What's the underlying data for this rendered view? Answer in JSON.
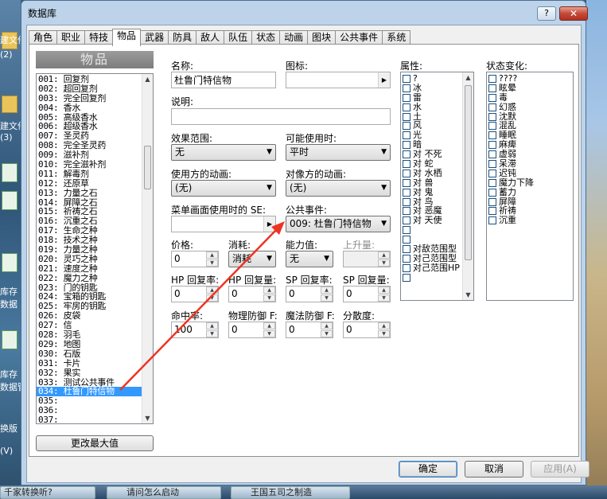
{
  "desktop": {
    "labels": [
      "建文件",
      "(2)",
      "建文件",
      "(3)",
      "库存",
      "数据",
      "库存",
      "数据管",
      "换版",
      "(V)"
    ]
  },
  "window": {
    "title": "数据库",
    "help": "?",
    "close": "✕"
  },
  "tabs": [
    "角色",
    "职业",
    "特技",
    "物品",
    "武器",
    "防具",
    "敌人",
    "队伍",
    "状态",
    "动画",
    "图块",
    "公共事件",
    "系统"
  ],
  "items": {
    "header": "物品",
    "list": [
      "001: 回复剂",
      "002: 超回复剂",
      "003: 完全回复剂",
      "004: 香水",
      "005: 高级香水",
      "006: 超级香水",
      "007: 圣灵药",
      "008: 完全圣灵药",
      "009: 滋补剂",
      "010: 完全滋补剂",
      "011: 解毒剂",
      "012: 还原草",
      "013: 力量之石",
      "014: 屏障之石",
      "015: 祈祷之石",
      "016: 沉重之石",
      "017: 生命之种",
      "018: 技术之种",
      "019: 力量之种",
      "020: 灵巧之种",
      "021: 速度之种",
      "022: 魔力之种",
      "023: 门的钥匙",
      "024: 宝箱的钥匙",
      "025: 牢房的钥匙",
      "026: 皮袋",
      "027: 信",
      "028: 羽毛",
      "029: 地图",
      "030: 石版",
      "031: 卡片",
      "032: 果实",
      "033: 测试公共事件",
      "034: 杜鲁门特信物",
      "035:",
      "036:",
      "037:"
    ],
    "selected_index": 33,
    "max_button": "更改最大值"
  },
  "form": {
    "name_label": "名称:",
    "name_value": "杜鲁门特信物",
    "icon_label": "图标:",
    "desc_label": "说明:",
    "scope_label": "效果范围:",
    "scope_value": "无",
    "occasion_label": "可能使用时:",
    "occasion_value": "平时",
    "user_anim_label": "使用方的动画:",
    "user_anim_value": "(无)",
    "target_anim_label": "对像方的动画:",
    "target_anim_value": "(无)",
    "se_label": "菜单画面使用时的 SE:",
    "common_event_label": "公共事件:",
    "common_event_value": "009: 杜鲁门特信物",
    "price_label": "价格:",
    "price_value": "0",
    "consume_label": "消耗:",
    "consume_value": "消耗",
    "param_label": "能力值:",
    "param_value": "无",
    "raise_label": "上升量:",
    "hp_rate_label": "HP 回复率:",
    "hp_rate_value": "0",
    "hp_amt_label": "HP 回复量:",
    "hp_amt_value": "0",
    "sp_rate_label": "SP 回复率:",
    "sp_rate_value": "0",
    "sp_amt_label": "SP 回复量:",
    "sp_amt_value": "0",
    "hit_label": "命中率:",
    "hit_value": "100",
    "pdef_label": "物理防御 F:",
    "pdef_value": "0",
    "mdef_label": "魔法防御 F:",
    "mdef_value": "0",
    "var_label": "分散度:",
    "var_value": "0"
  },
  "attributes": {
    "label": "属性:",
    "items": [
      "?",
      "冰",
      "雷",
      "水",
      "土",
      "风",
      "光",
      "暗",
      "对 不死",
      "对 蛇",
      "对 水栖",
      "对 兽",
      "对 鬼",
      "对 鸟",
      "对 恶魔",
      "对 天使",
      "",
      "",
      "对敌范围型",
      "对己范围型",
      "对己范围HP",
      ""
    ]
  },
  "states": {
    "label": "状态变化:",
    "items": [
      "????",
      "眩晕",
      "毒",
      "幻惑",
      "沈默",
      "混乱",
      "睡眠",
      "麻痺",
      "虚弱",
      "呆滞",
      "迟钝",
      "魔力下降",
      "蓄力",
      "屏障",
      "祈祷",
      "沉重"
    ]
  },
  "buttons": {
    "ok": "确定",
    "cancel": "取消",
    "apply": "应用(A)"
  },
  "taskbar": [
    "千家转换听?",
    "请问怎么启动",
    "王国五司之制造"
  ],
  "accent_color": "#3399ff",
  "arrow_color": "#ee3322"
}
